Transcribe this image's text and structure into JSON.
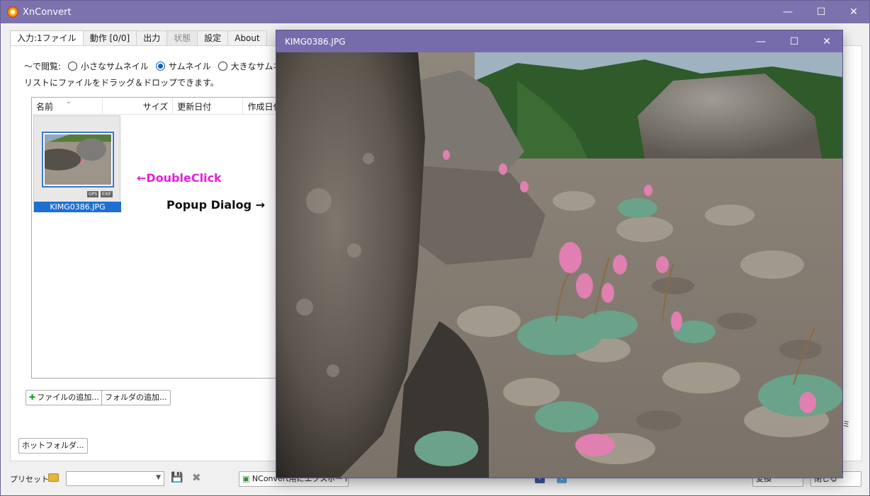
{
  "main_window": {
    "title": "XnConvert",
    "controls": {
      "minimize": "—",
      "maximize": "☐",
      "close": "✕"
    }
  },
  "tabs": [
    {
      "label": "入力:1ファイル",
      "active": true
    },
    {
      "label": "動作 [0/0]"
    },
    {
      "label": "出力"
    },
    {
      "label": "状態",
      "disabled": true
    },
    {
      "label": "設定"
    },
    {
      "label": "About"
    }
  ],
  "view": {
    "label": "〜で閲覧:",
    "options": [
      "小さなサムネイル",
      "サムネイル",
      "大きなサムネイル"
    ],
    "selected": "サムネイル"
  },
  "hint": "リストにファイルをドラッグ＆ドロップできます。",
  "file_list": {
    "columns": [
      "名前",
      "サイズ",
      "更新日付",
      "作成日付"
    ],
    "sort_indicator": "⌄",
    "items": [
      {
        "name": "KIMG0386.JPG",
        "badges": [
          "GPS",
          "EXIF"
        ]
      }
    ]
  },
  "annotations": {
    "double_click": "←DoubleClick",
    "popup": "Popup Dialog →"
  },
  "buttons": {
    "add_files": "ファイルの追加...",
    "add_folder": "フォルダの追加...",
    "hot_folder": "ホットフォルダ...",
    "nconvert": "NConvert用にエクスポート...",
    "convert": "変換",
    "close": "閉じる"
  },
  "bottom": {
    "preset_label": "プリセット:",
    "preset_value": "",
    "fb": "f",
    "tw": "t"
  },
  "side_char": "ミ",
  "dialog": {
    "title": "KIMG0386.JPG",
    "controls": {
      "minimize": "—",
      "maximize": "☐",
      "close": "✕"
    }
  }
}
